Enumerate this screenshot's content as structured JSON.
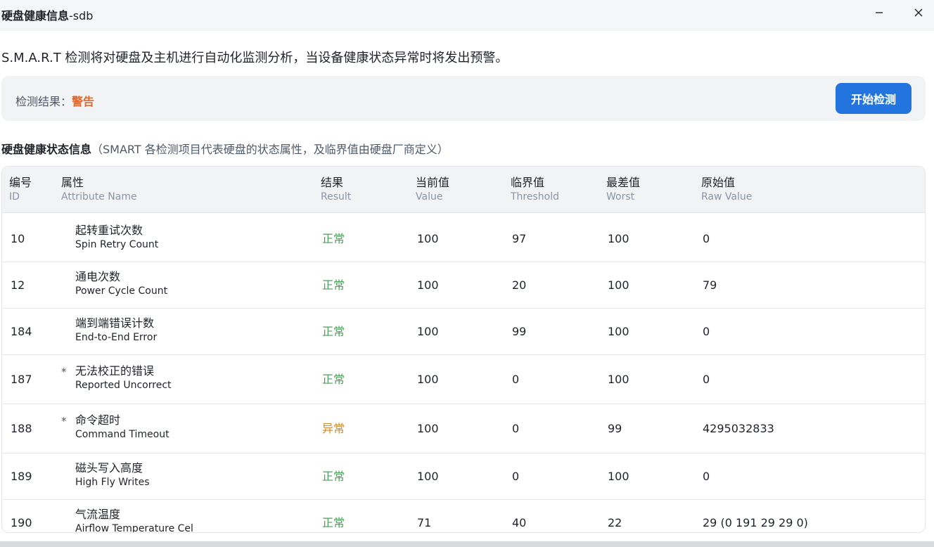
{
  "window": {
    "title_bold": "硬盘健康信息",
    "title_suffix": "-sdb"
  },
  "description": "S.M.A.R.T 检测将对硬盘及主机进行自动化监测分析，当设备健康状态异常时将发出预警。",
  "result": {
    "label": "检测结果：",
    "value": "警告",
    "start_button": "开始检测"
  },
  "section": {
    "title": "硬盘健康状态信息",
    "subtitle": "（SMART 各检测项目代表硬盘的状态属性，及临界值由硬盘厂商定义）"
  },
  "table": {
    "headers": [
      {
        "cn": "编号",
        "en": "ID"
      },
      {
        "cn": "属性",
        "en": "Attribute Name"
      },
      {
        "cn": "结果",
        "en": "Result"
      },
      {
        "cn": "当前值",
        "en": "Value"
      },
      {
        "cn": "临界值",
        "en": "Threshold"
      },
      {
        "cn": "最差值",
        "en": "Worst"
      },
      {
        "cn": "原始值",
        "en": "Raw Value"
      }
    ],
    "rows": [
      {
        "id": "10",
        "star": "",
        "name_cn": "起转重试次数",
        "name_en": "Spin Retry Count",
        "result": "正常",
        "status": "ok",
        "value": "100",
        "threshold": "97",
        "worst": "100",
        "raw": "0"
      },
      {
        "id": "12",
        "star": "",
        "name_cn": "通电次数",
        "name_en": "Power Cycle Count",
        "result": "正常",
        "status": "ok",
        "value": "100",
        "threshold": "20",
        "worst": "100",
        "raw": "79"
      },
      {
        "id": "184",
        "star": "",
        "name_cn": "端到端错误计数",
        "name_en": "End-to-End Error",
        "result": "正常",
        "status": "ok",
        "value": "100",
        "threshold": "99",
        "worst": "100",
        "raw": "0"
      },
      {
        "id": "187",
        "star": "*",
        "name_cn": "无法校正的错误",
        "name_en": "Reported Uncorrect",
        "result": "正常",
        "status": "ok",
        "value": "100",
        "threshold": "0",
        "worst": "100",
        "raw": "0"
      },
      {
        "id": "188",
        "star": "*",
        "name_cn": "命令超时",
        "name_en": "Command Timeout",
        "result": "异常",
        "status": "bad",
        "value": "100",
        "threshold": "0",
        "worst": "99",
        "raw": "4295032833"
      },
      {
        "id": "189",
        "star": "",
        "name_cn": "磁头写入高度",
        "name_en": "High Fly Writes",
        "result": "正常",
        "status": "ok",
        "value": "100",
        "threshold": "0",
        "worst": "100",
        "raw": "0"
      },
      {
        "id": "190",
        "star": "",
        "name_cn": "气流温度",
        "name_en": "Airflow Temperature Cel",
        "result": "正常",
        "status": "ok",
        "value": "71",
        "threshold": "40",
        "worst": "22",
        "raw": "29 (0 191 29 29 0)"
      }
    ]
  },
  "colors": {
    "accent": "#2474e0",
    "warning": "#e0662c",
    "ok": "#4b9e5a",
    "abnormal": "#d0862a"
  },
  "icons": {
    "minimize": "minimize-icon",
    "close": "close-icon"
  }
}
